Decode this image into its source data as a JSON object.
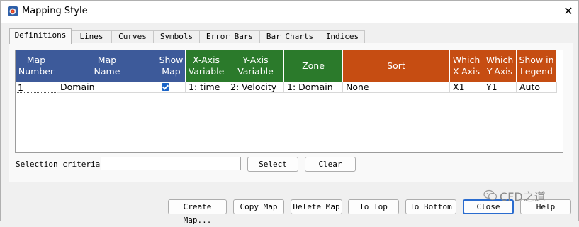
{
  "window": {
    "title": "Mapping Style",
    "close_symbol": "✕"
  },
  "tabs": [
    "Definitions",
    "Lines",
    "Curves",
    "Symbols",
    "Error Bars",
    "Bar Charts",
    "Indices"
  ],
  "active_tab": "Definitions",
  "colors": {
    "blue_header": "#3d5a9a",
    "green_header": "#2b7a2b",
    "orange_header": "#c64d12",
    "checkbox": "#1a64c8",
    "default_button_border": "#2a6ccf"
  },
  "table": {
    "columns": [
      {
        "line1": "Map",
        "line2": "Number",
        "group": "blue"
      },
      {
        "line1": "Map",
        "line2": "Name",
        "group": "blue"
      },
      {
        "line1": "Show",
        "line2": "Map",
        "group": "blue"
      },
      {
        "line1": "X-Axis",
        "line2": "Variable",
        "group": "green"
      },
      {
        "line1": "Y-Axis",
        "line2": "Variable",
        "group": "green"
      },
      {
        "line1": "Zone",
        "line2": "",
        "group": "green"
      },
      {
        "line1": "Sort",
        "line2": "",
        "group": "orange"
      },
      {
        "line1": "Which",
        "line2": "X-Axis",
        "group": "orange"
      },
      {
        "line1": "Which",
        "line2": "Y-Axis",
        "group": "orange"
      },
      {
        "line1": "Show in",
        "line2": "Legend",
        "group": "orange"
      }
    ],
    "rows": [
      {
        "number": "1",
        "name": "Domain",
        "show_map": true,
        "x_var": "1: time",
        "y_var": "2: Velocity",
        "zone": "1: Domain",
        "sort": "None",
        "which_x": "X1",
        "which_y": "Y1",
        "legend": "Auto"
      }
    ]
  },
  "selection": {
    "label": "Selection criteria:",
    "value": "",
    "select_label": "Select",
    "clear_label": "Clear"
  },
  "buttons": {
    "create_map": "Create Map...",
    "copy_map": "Copy Map",
    "delete_map": "Delete Map",
    "to_top": "To Top",
    "to_bottom": "To Bottom",
    "close": "Close",
    "help": "Help"
  },
  "watermark": "CFD之道"
}
